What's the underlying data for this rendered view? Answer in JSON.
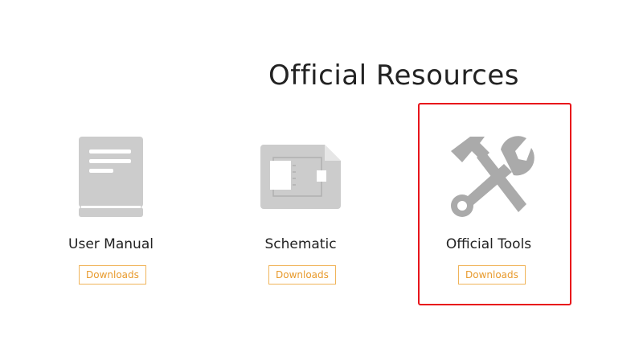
{
  "page": {
    "title": "Official Resources"
  },
  "resources": [
    {
      "label": "User Manual",
      "button": "Downloads",
      "icon": "book-icon"
    },
    {
      "label": "Schematic",
      "button": "Downloads",
      "icon": "schematic-icon"
    },
    {
      "label": "Official Tools",
      "button": "Downloads",
      "icon": "tools-icon"
    }
  ],
  "colors": {
    "accent": "#e89a2c",
    "icon_gray": "#cccccc",
    "highlight": "#e8151b"
  }
}
